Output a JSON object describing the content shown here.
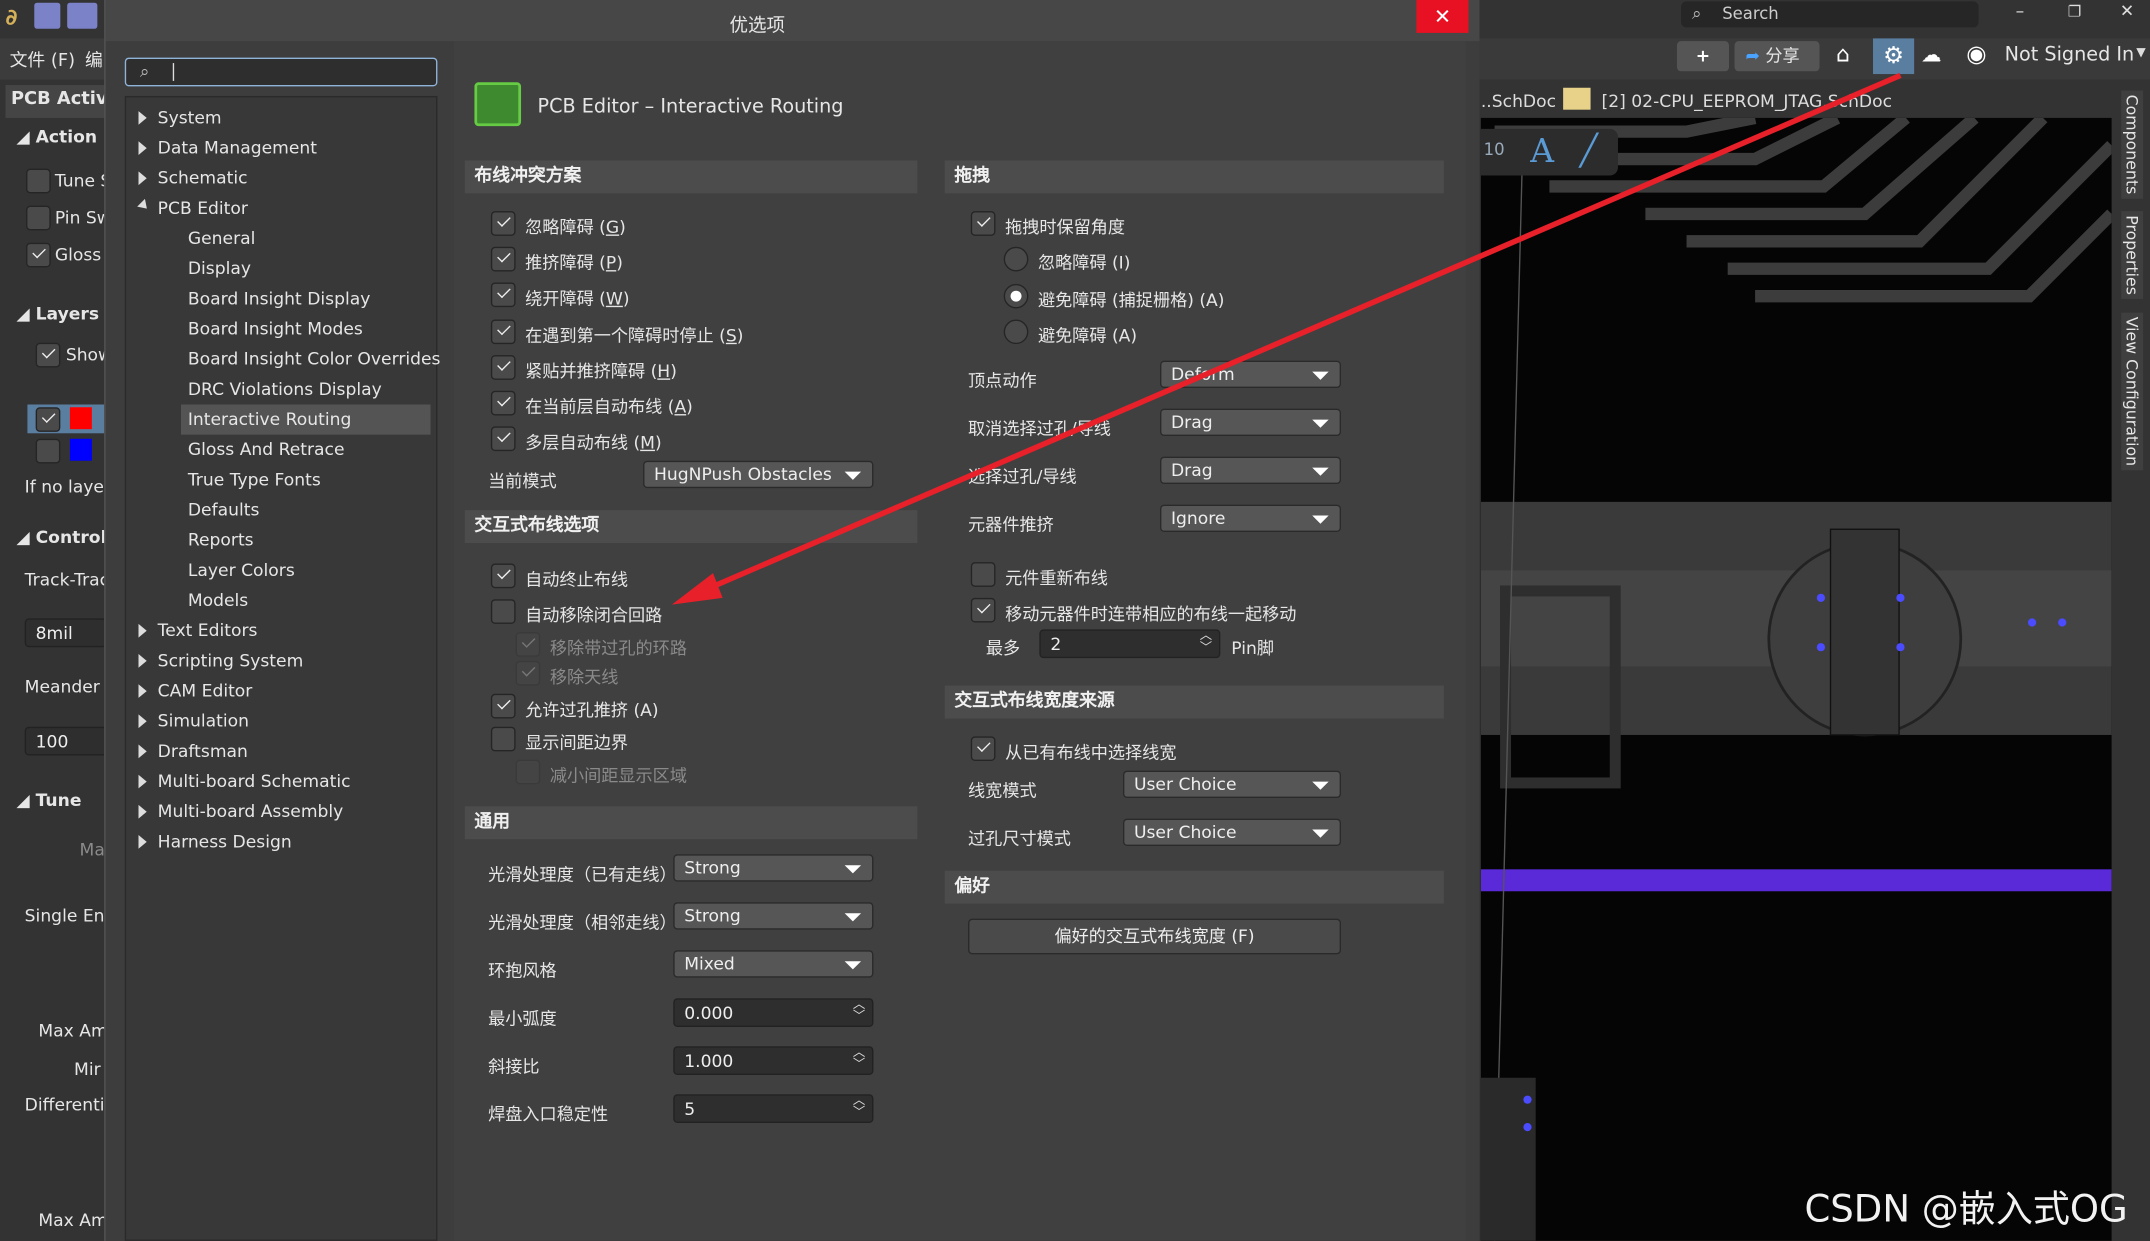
{
  "app": {
    "menu_file": "文件 (F)",
    "menu_edit_partial": "编",
    "panel_title": "PCB Active",
    "sections": {
      "action": "Action",
      "layers": "Layers",
      "control": "Control",
      "tune": "Tune"
    },
    "action_items": [
      {
        "label": "Tune S",
        "checked": false
      },
      {
        "label": "Pin Sw",
        "checked": false
      },
      {
        "label": "Gloss",
        "checked": true
      }
    ],
    "layers_show": "Show",
    "layer_colors": [
      "#ff0000",
      "#0000ff"
    ],
    "if_no_layer": "If no layer",
    "track_track": "Track-Trac",
    "track_value": "8mil",
    "meander": "Meander ",
    "meander_value": "100",
    "tune_placeholder": "Ma",
    "single_ended": "Single Enc",
    "max_amp1": "Max Am",
    "min": "Mir",
    "differential": "Differentia",
    "max_amp2": "Max Am",
    "search_placeholder": "Search",
    "share_label": "分享",
    "not_signed_in": "Not Signed In",
    "doc_tab1": "..SchDoc",
    "doc_tab2": "[2] 02-CPU_EEPROM_JTAG.SchDoc",
    "right_tabs": [
      "Components",
      "Properties",
      "View Configuration"
    ],
    "watermark": "CSDN @嵌入式OG"
  },
  "dialog": {
    "title": "优选项",
    "search_value": "",
    "tree": [
      {
        "label": "System",
        "expanded": false
      },
      {
        "label": "Data Management",
        "expanded": false
      },
      {
        "label": "Schematic",
        "expanded": false
      },
      {
        "label": "PCB Editor",
        "expanded": true,
        "children": [
          "General",
          "Display",
          "Board Insight Display",
          "Board Insight Modes",
          "Board Insight Color Overrides",
          "DRC Violations Display",
          "Interactive Routing",
          "Gloss And Retrace",
          "True Type Fonts",
          "Defaults",
          "Reports",
          "Layer Colors",
          "Models"
        ]
      },
      {
        "label": "Text Editors",
        "expanded": false
      },
      {
        "label": "Scripting System",
        "expanded": false
      },
      {
        "label": "CAM Editor",
        "expanded": false
      },
      {
        "label": "Simulation",
        "expanded": false
      },
      {
        "label": "Draftsman",
        "expanded": false
      },
      {
        "label": "Multi-board Schematic",
        "expanded": false
      },
      {
        "label": "Multi-board Assembly",
        "expanded": false
      },
      {
        "label": "Harness Design",
        "expanded": false
      }
    ],
    "selected": "Interactive Routing",
    "page_title": "PCB Editor – Interactive Routing",
    "conflict": {
      "header": "布线冲突方案",
      "options": [
        {
          "label": "忽略障碍",
          "key": "G",
          "checked": true
        },
        {
          "label": "推挤障碍",
          "key": "P",
          "checked": true
        },
        {
          "label": "绕开障碍",
          "key": "W",
          "checked": true
        },
        {
          "label": "在遇到第一个障碍时停止",
          "key": "S",
          "checked": true
        },
        {
          "label": "紧贴并推挤障碍",
          "key": "H",
          "checked": true
        },
        {
          "label": "在当前层自动布线",
          "key": "A",
          "checked": true
        },
        {
          "label": "多层自动布线",
          "key": "M",
          "checked": true
        }
      ],
      "mode_label": "当前模式",
      "mode_value": "HugNPush Obstacles"
    },
    "interactive": {
      "header": "交互式布线选项",
      "options": [
        {
          "label": "自动终止布线",
          "checked": true,
          "disabled": false,
          "indent": false
        },
        {
          "label": "自动移除闭合回路",
          "checked": false,
          "disabled": false,
          "indent": false
        },
        {
          "label": "移除带过孔的环路",
          "checked": true,
          "disabled": true,
          "indent": true
        },
        {
          "label": "移除天线",
          "checked": true,
          "disabled": true,
          "indent": true
        },
        {
          "label": "允许过孔推挤 (A)",
          "checked": true,
          "disabled": false,
          "indent": false
        },
        {
          "label": "显示间距边界",
          "checked": false,
          "disabled": false,
          "indent": false
        },
        {
          "label": "减小间距显示区域",
          "checked": false,
          "disabled": true,
          "indent": true
        }
      ]
    },
    "general": {
      "header": "通用",
      "rows": [
        {
          "label": "光滑处理度（已有走线）",
          "value": "Strong",
          "type": "dropdown"
        },
        {
          "label": "光滑处理度（相邻走线）",
          "value": "Strong",
          "type": "dropdown"
        },
        {
          "label": "环抱风格",
          "value": "Mixed",
          "type": "dropdown"
        },
        {
          "label": "最小弧度",
          "value": "0.000",
          "type": "spin"
        },
        {
          "label": "斜接比",
          "value": "1.000",
          "type": "spin"
        },
        {
          "label": "焊盘入口稳定性",
          "value": "5",
          "type": "spin"
        }
      ]
    },
    "drag": {
      "header": "拖拽",
      "preserve_angle": {
        "label": "拖拽时保留角度",
        "checked": true
      },
      "radios": [
        {
          "label": "忽略障碍 (I)",
          "selected": false
        },
        {
          "label": "避免障碍 (捕捉栅格) (A)",
          "selected": true
        },
        {
          "label": "避免障碍 (A)",
          "selected": false
        }
      ],
      "rows": [
        {
          "label": "顶点动作",
          "value": "Deform"
        },
        {
          "label": "取消选择过孔/导线",
          "value": "Drag"
        },
        {
          "label": "选择过孔/导线",
          "value": "Drag"
        },
        {
          "label": "元器件推挤",
          "value": "Ignore"
        }
      ],
      "reroute": {
        "label": "元件重新布线",
        "checked": false
      },
      "move_with": {
        "label": "移动元器件时连带相应的布线一起移动",
        "checked": true
      },
      "max_label": "最多",
      "max_value": "2",
      "max_unit": "Pin脚"
    },
    "width_source": {
      "header": "交互式布线宽度来源",
      "pick": {
        "label": "从已有布线中选择线宽",
        "checked": true
      },
      "rows": [
        {
          "label": "线宽模式",
          "value": "User Choice"
        },
        {
          "label": "过孔尺寸模式",
          "value": "User Choice"
        }
      ]
    },
    "favorites": {
      "header": "偏好",
      "button": "偏好的交互式布线宽度 (F)"
    }
  },
  "colors": {
    "annotation_arrow": "#e8202a",
    "close_button": "#e81123",
    "selected_tool": "#5a7ea0",
    "highlight_bar": "#5a2ad8"
  }
}
